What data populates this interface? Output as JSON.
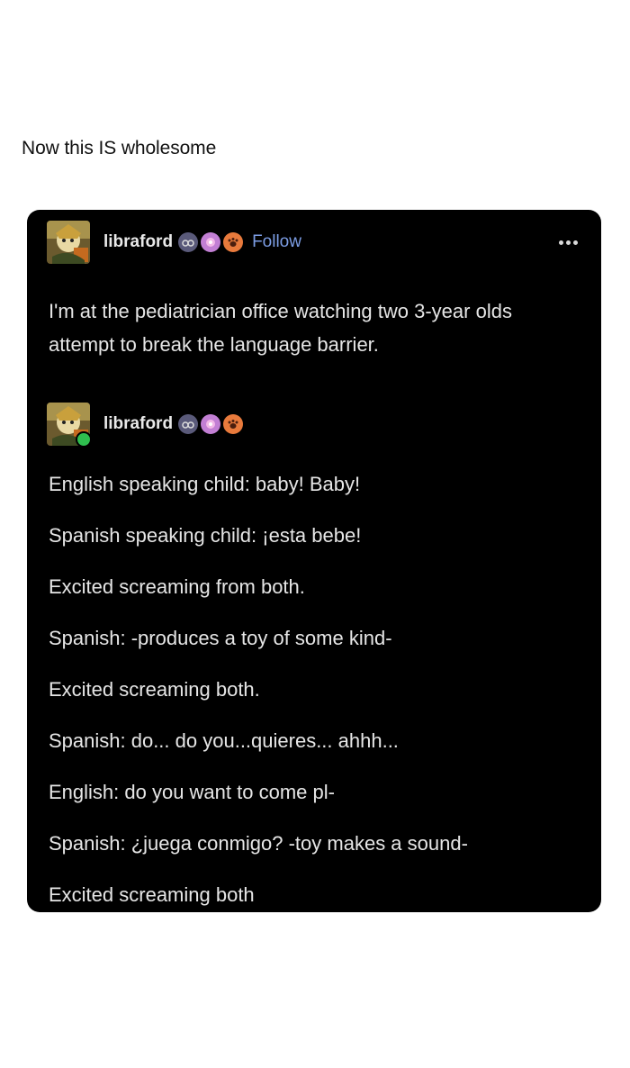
{
  "caption": "Now this IS wholesome",
  "post": {
    "username": "libraford",
    "follow_label": "Follow",
    "text": "I'm at the pediatrician office watching two 3-year olds attempt to break the language barrier.",
    "badges": [
      "glasses-badge-icon",
      "pink-flower-badge-icon",
      "paw-badge-icon"
    ],
    "more_icon": "more-options-icon",
    "colors": {
      "card_bg": "#000000",
      "text": "#e6e6e6",
      "follow": "#7c9de4"
    }
  },
  "reblog": {
    "username": "libraford",
    "lines": [
      "English speaking child: baby! Baby!",
      "Spanish speaking child: ¡esta bebe!",
      "Excited screaming from both.",
      "Spanish: -produces a toy of some kind-",
      "Excited screaming both.",
      "Spanish: do... do you...quieres... ahhh...",
      "English: do you want to come pl-",
      "Spanish: ¿juega conmigo? -toy makes a sound-",
      "Excited screaming both"
    ]
  }
}
